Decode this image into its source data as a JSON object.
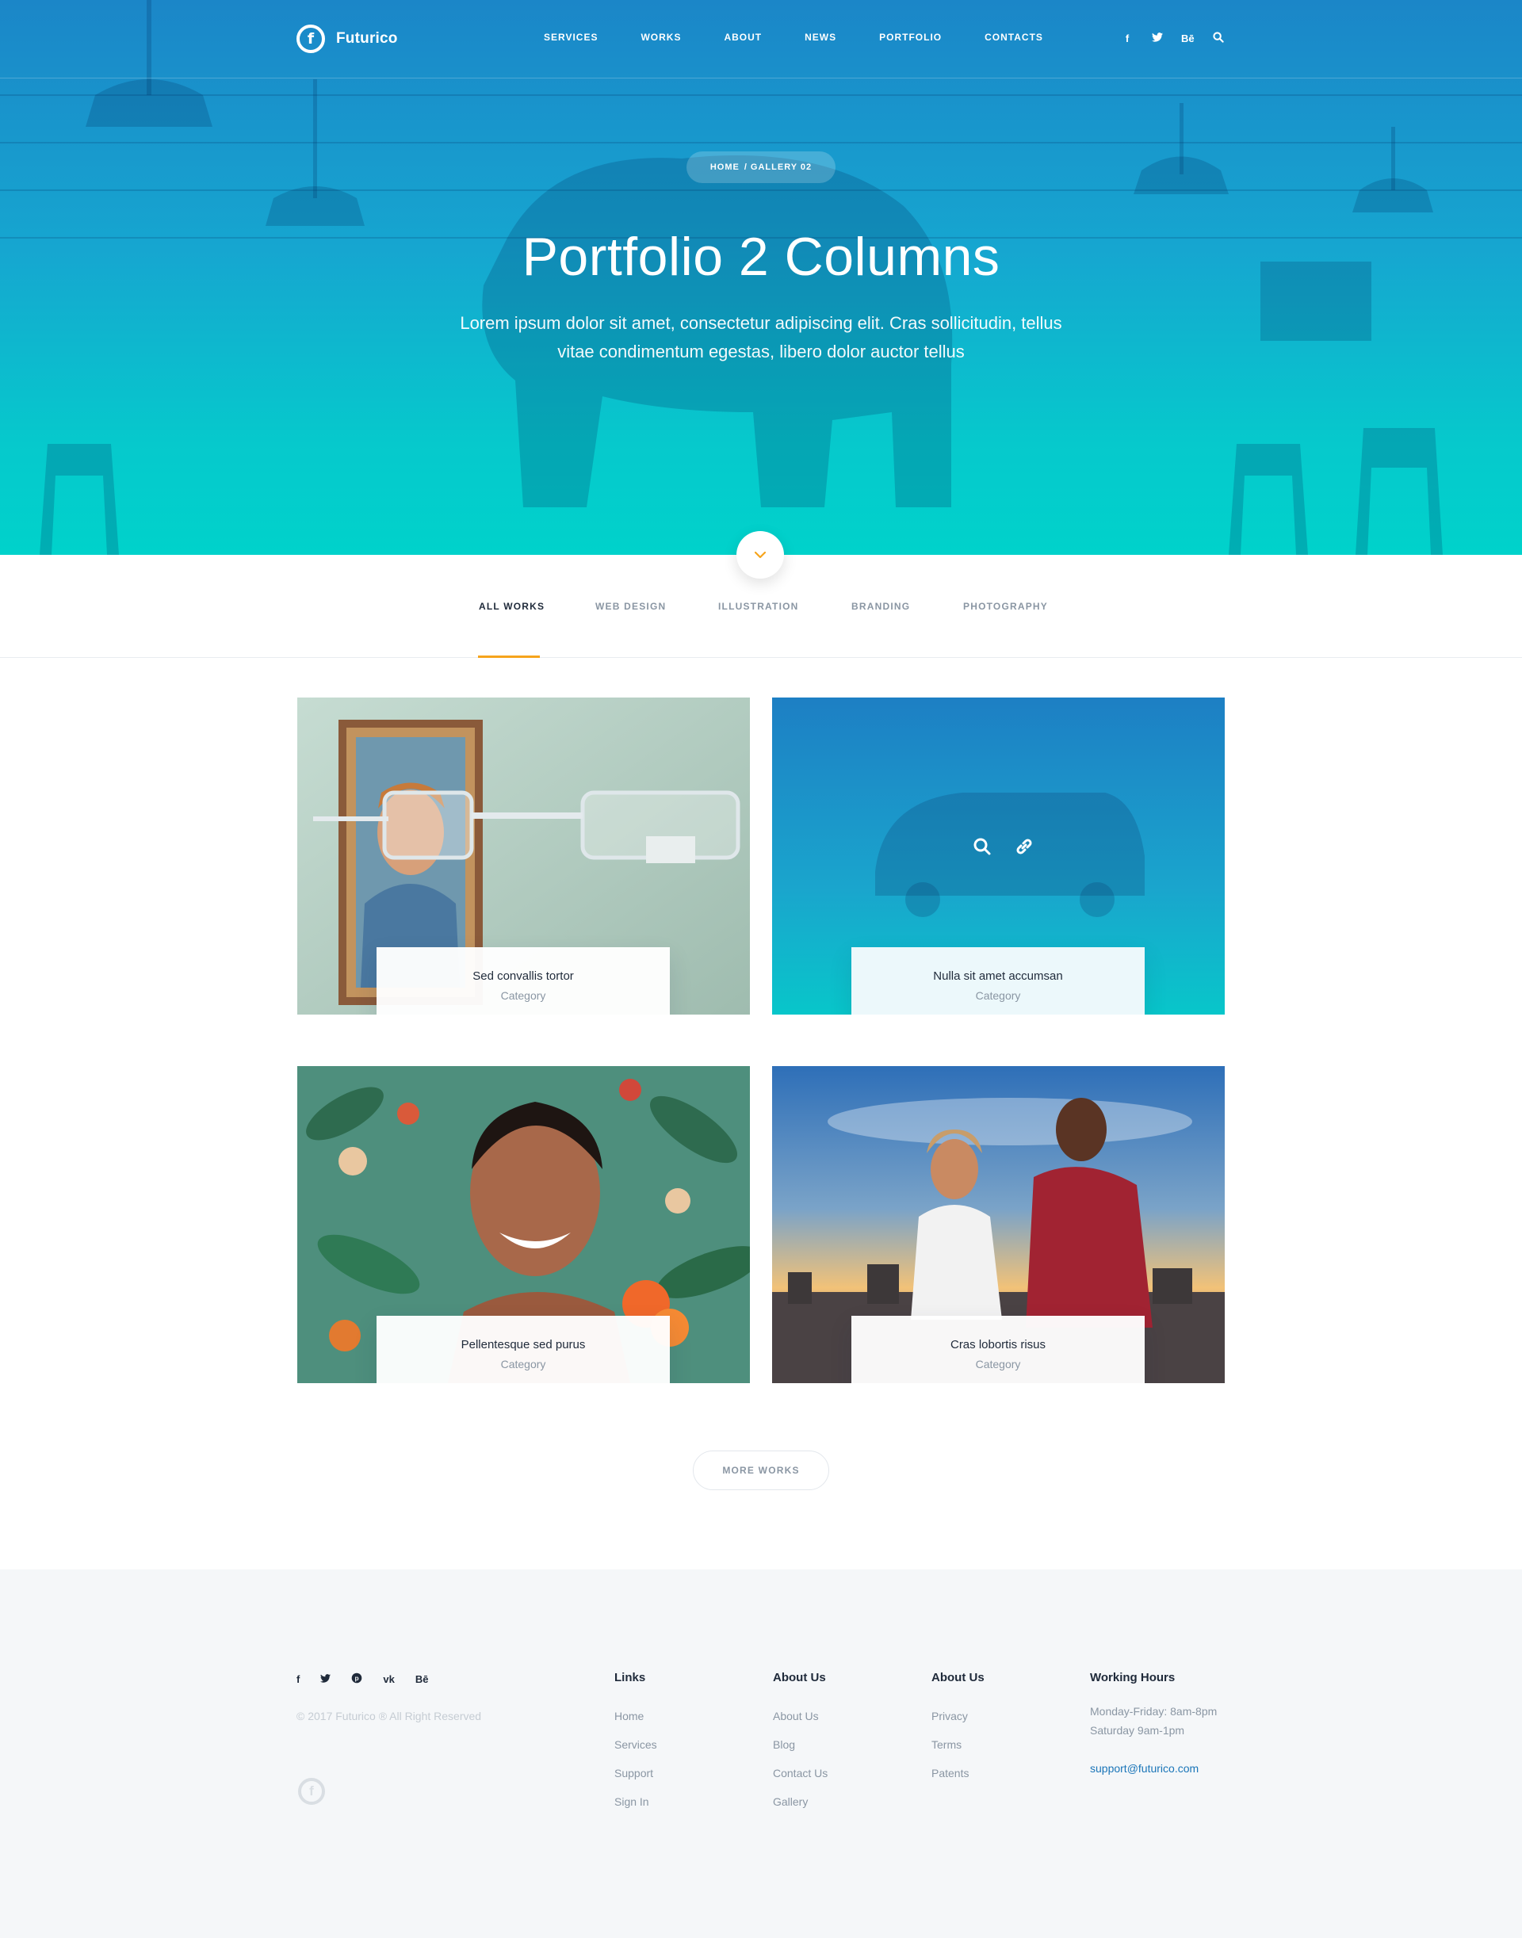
{
  "header": {
    "brand": "Futurico",
    "logo_letter": "f",
    "menu": [
      "SERVICES",
      "WORKS",
      "ABOUT",
      "NEWS",
      "PORTFOLIO",
      "CONTACTS"
    ],
    "social": [
      "f",
      "t",
      "Bē",
      "search"
    ]
  },
  "hero": {
    "breadcrumb_home": "HOME",
    "breadcrumb_current": "/ GALLERY 02",
    "title": "Portfolio 2 Columns",
    "subtitle": "Lorem ipsum dolor sit amet, consectetur adipiscing elit. Cras sollicitudin, tellus vitae condimentum egestas, libero dolor auctor tellus"
  },
  "filters": {
    "tabs": [
      "ALL WORKS",
      "WEB DESIGN",
      "ILLUSTRATION",
      "BRANDING",
      "PHOTOGRAPHY"
    ],
    "active": "ALL WORKS"
  },
  "works": [
    {
      "title": "Sed convallis tortor",
      "category": "Category"
    },
    {
      "title": "Nulla sit amet accumsan",
      "category": "Category"
    },
    {
      "title": "Pellentesque sed purus",
      "category": "Category"
    },
    {
      "title": "Cras lobortis risus",
      "category": "Category"
    }
  ],
  "more_button": "MORE WORKS",
  "footer": {
    "social": [
      "f",
      "t",
      "p",
      "vk",
      "Bē"
    ],
    "copyright": "© 2017 Futurico ® All Right Reserved",
    "col1": {
      "title": "Links",
      "items": [
        "Home",
        "Services",
        "Support",
        "Sign In"
      ]
    },
    "col2": {
      "title": "About Us",
      "items": [
        "About Us",
        "Blog",
        "Contact Us",
        "Gallery"
      ]
    },
    "col3": {
      "title": "About Us",
      "items": [
        "Privacy",
        "Terms",
        "Patents"
      ]
    },
    "col4": {
      "title": "Working Hours",
      "line1": "Monday-Friday: 8am-8pm",
      "line2": "Saturday 9am-1pm",
      "email": "support@futurico.com"
    }
  }
}
